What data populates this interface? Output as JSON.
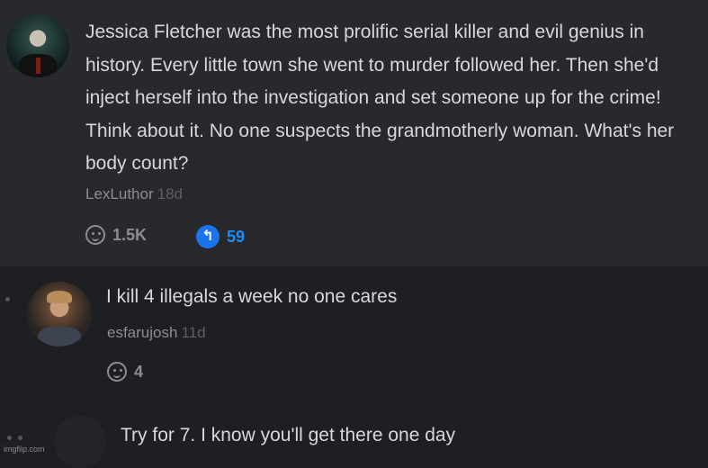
{
  "comments": [
    {
      "author": "LexLuthor",
      "age": "18d",
      "body": "Jessica Fletcher was the most prolific serial killer and evil genius in history. Every little town she went to murder followed her. Then she'd inject herself into the investigation and set someone up for the crime! Think about it. No one suspects the grandmotherly woman. What's her body count?",
      "likes": "1.5K",
      "replies": "59"
    },
    {
      "author": "esfarujosh",
      "age": "11d",
      "body": "I kill 4 illegals a week no one cares",
      "likes": "4"
    },
    {
      "body": "Try for 7. I know you'll get there one day"
    }
  ],
  "icons": {
    "like": "smiley-face-icon",
    "reply": "reply-arrow-icon",
    "reply_glyph": "↰"
  },
  "colors": {
    "accent": "#1a73e8",
    "background": "#1e1f22",
    "highlight_card": "#28292d"
  },
  "watermark": "imgflip.com"
}
